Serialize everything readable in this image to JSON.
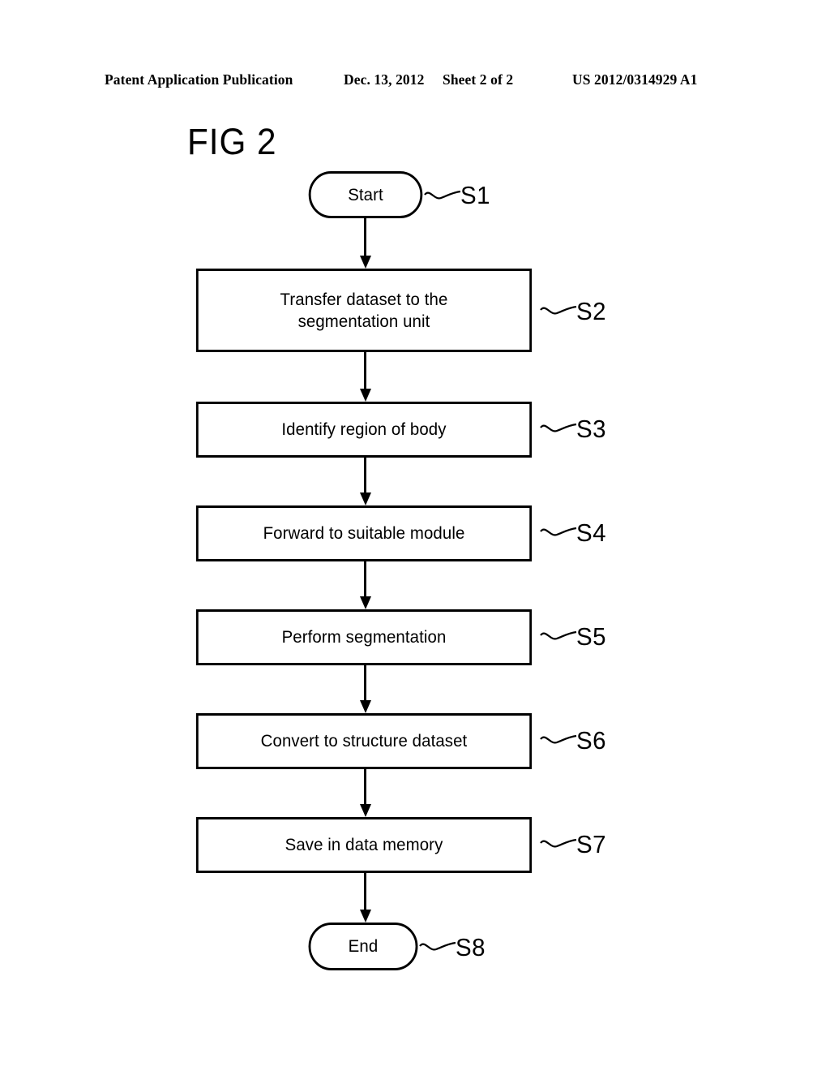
{
  "header": {
    "publication": "Patent Application Publication",
    "date": "Dec. 13, 2012",
    "sheet": "Sheet 2 of 2",
    "number": "US 2012/0314929 A1"
  },
  "figure": {
    "title": "FIG 2",
    "nodes": [
      {
        "id": "S1",
        "label": "Start",
        "ref": "S1",
        "shape": "terminator"
      },
      {
        "id": "S2",
        "label": "Transfer dataset to the\nsegmentation unit",
        "ref": "S2",
        "shape": "process"
      },
      {
        "id": "S3",
        "label": "Identify region of body",
        "ref": "S3",
        "shape": "process"
      },
      {
        "id": "S4",
        "label": "Forward to suitable module",
        "ref": "S4",
        "shape": "process"
      },
      {
        "id": "S5",
        "label": "Perform segmentation",
        "ref": "S5",
        "shape": "process"
      },
      {
        "id": "S6",
        "label": "Convert to structure dataset",
        "ref": "S6",
        "shape": "process"
      },
      {
        "id": "S7",
        "label": "Save in data memory",
        "ref": "S7",
        "shape": "process"
      },
      {
        "id": "S8",
        "label": "End",
        "ref": "S8",
        "shape": "terminator"
      }
    ],
    "flow": [
      {
        "from": "S1",
        "to": "S2"
      },
      {
        "from": "S2",
        "to": "S3"
      },
      {
        "from": "S3",
        "to": "S4"
      },
      {
        "from": "S4",
        "to": "S5"
      },
      {
        "from": "S5",
        "to": "S6"
      },
      {
        "from": "S6",
        "to": "S7"
      },
      {
        "from": "S7",
        "to": "S8"
      }
    ]
  }
}
